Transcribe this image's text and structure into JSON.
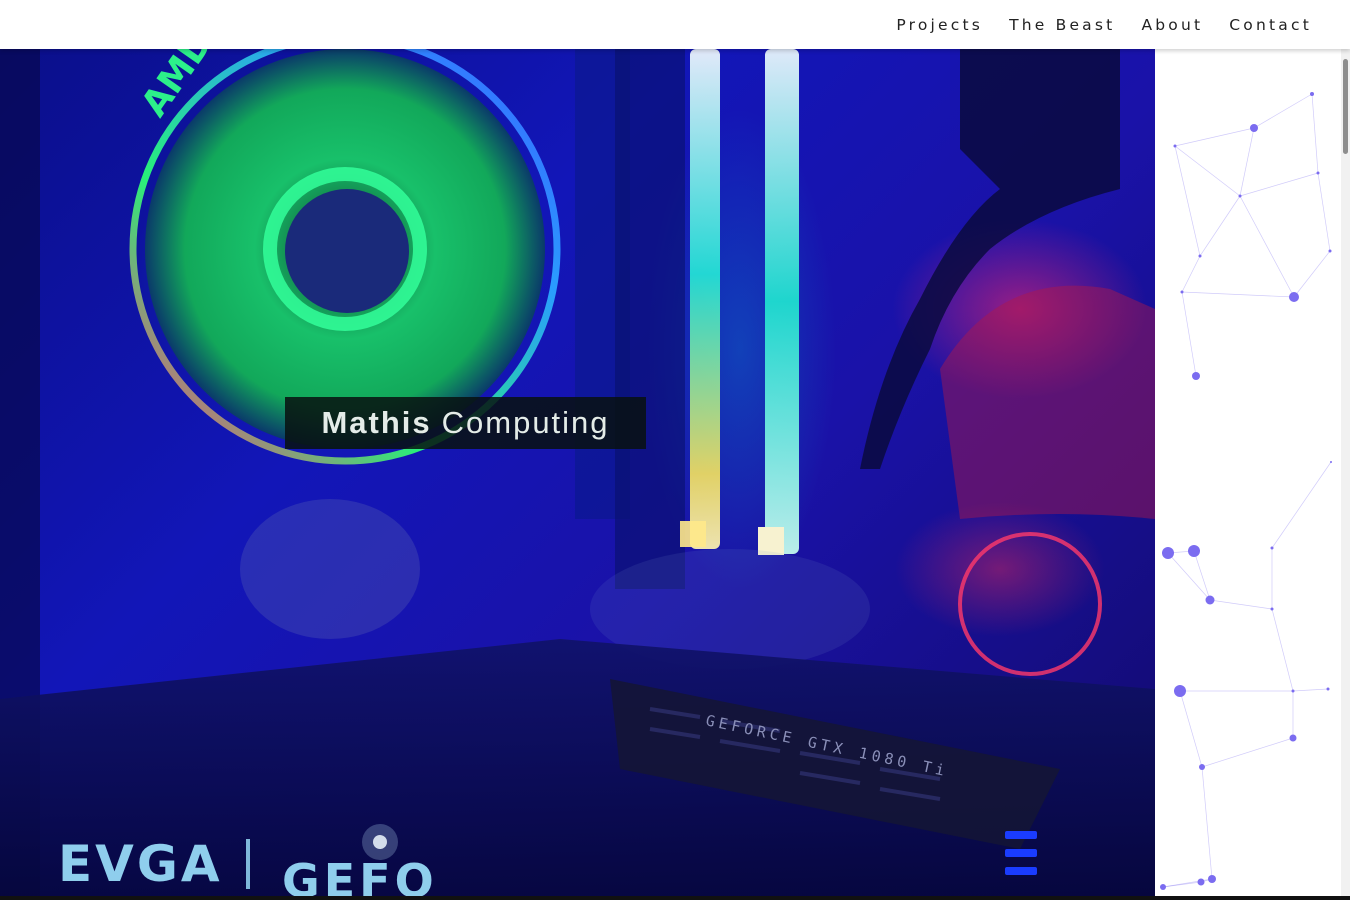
{
  "nav": {
    "items": [
      {
        "label": "Projects"
      },
      {
        "label": "The Beast"
      },
      {
        "label": "About"
      },
      {
        "label": "Contact"
      }
    ]
  },
  "hero": {
    "title_bold": "Mathis",
    "title_rest": "Computing",
    "photo_text": {
      "cooler_brand": "AMD",
      "card_brand": "EVGA",
      "card_series": "GEFO",
      "card_model": "GEFORCE GTX 1080 Ti"
    }
  },
  "colors": {
    "accent_particles": "#7b6cf0",
    "hero_blue": "#1216b8",
    "fan_green": "#1ee07a",
    "ram_cyan": "#22e8d8"
  }
}
